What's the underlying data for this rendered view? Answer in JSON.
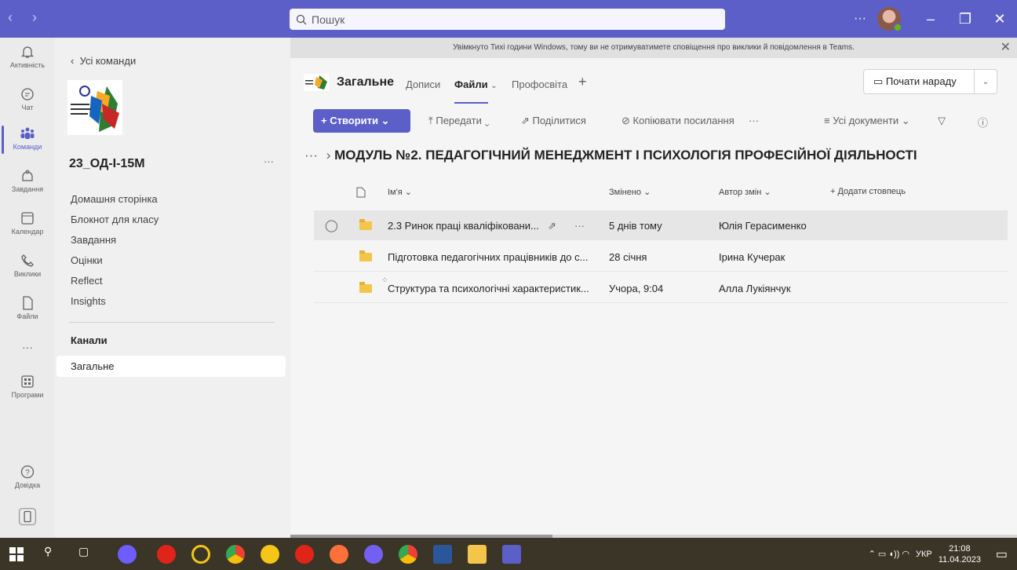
{
  "titlebar": {
    "search_placeholder": "Пошук",
    "more": "···"
  },
  "rail": [
    {
      "label": "Активність",
      "icon": "bell-icon"
    },
    {
      "label": "Чат",
      "icon": "chat-icon"
    },
    {
      "label": "Команди",
      "icon": "teams-icon",
      "active": true
    },
    {
      "label": "Завдання",
      "icon": "assignments-icon"
    },
    {
      "label": "Календар",
      "icon": "calendar-icon"
    },
    {
      "label": "Виклики",
      "icon": "phone-icon"
    },
    {
      "label": "Файли",
      "icon": "file-icon"
    },
    {
      "label": "···",
      "icon": "more-icon"
    },
    {
      "label": "Програми",
      "icon": "apps-icon"
    },
    {
      "label": "Довідка",
      "icon": "help-icon"
    }
  ],
  "team": {
    "back_label": "Усі команди",
    "name": "23_ОД-І-15М",
    "more": "···",
    "nav": [
      "Домашня сторінка",
      "Блокнот для класу",
      "Завдання",
      "Оцінки",
      "Reflect",
      "Insights"
    ],
    "channels_heading": "Канали",
    "channels": [
      "Загальне"
    ]
  },
  "banner": "Увімкнуто Тихі години Windows, тому ви не отримуватимете сповіщення про виклики й повідомлення в Teams.",
  "channel": {
    "title": "Загальне",
    "tabs": [
      "Дописи",
      "Файли",
      "Профосвіта"
    ],
    "selected_tab": "Файли",
    "meet_label": "Почати нараду"
  },
  "toolbar": {
    "create": "Створити",
    "upload": "Передати",
    "share": "Поділитися",
    "copy_link": "Копіювати посилання",
    "more": "···",
    "view": "Усі документи"
  },
  "breadcrumb": {
    "dots": "···",
    "current": "МОДУЛЬ №2. ПЕДАГОГІЧНИЙ МЕНЕДЖМЕНТ І ПСИХОЛОГІЯ ПРОФЕСІЙНОЇ ДІЯЛЬНОСТІ"
  },
  "columns": {
    "name": "Ім'я",
    "modified": "Змінено",
    "author": "Автор змін",
    "add": "Додати стовпець"
  },
  "files": [
    {
      "name": "2.3 Ринок праці кваліфіковани...",
      "modified": "5 днів тому",
      "author": "Юлія Герасименко"
    },
    {
      "name": "Підготовка педагогічних працівників до с...",
      "modified": "28 січня",
      "author": "Ірина Кучерак"
    },
    {
      "name": "Структура та психологічні характеристик...",
      "modified": "Учора, 9:04",
      "author": "Алла Лукіянчук"
    }
  ],
  "taskbar": {
    "lang": "УКР",
    "time": "21:08",
    "date": "11.04.2023"
  },
  "colors": {
    "accent": "#5b5fc7",
    "folder": "#f4c54a"
  }
}
